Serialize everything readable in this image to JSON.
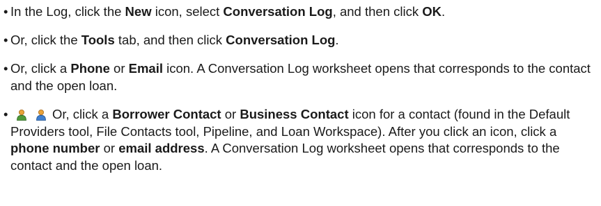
{
  "bullet_char": "•",
  "items": [
    {
      "segments": [
        {
          "text": "In the Log, click the ",
          "bold": false
        },
        {
          "text": "New",
          "bold": true
        },
        {
          "text": " icon, select ",
          "bold": false
        },
        {
          "text": "Conversation Log",
          "bold": true
        },
        {
          "text": ", and then click ",
          "bold": false
        },
        {
          "text": "OK",
          "bold": true
        },
        {
          "text": ".",
          "bold": false
        }
      ]
    },
    {
      "segments": [
        {
          "text": "Or, click the ",
          "bold": false
        },
        {
          "text": "Tools",
          "bold": true
        },
        {
          "text": " tab, and then click ",
          "bold": false
        },
        {
          "text": "Conversation Log",
          "bold": true
        },
        {
          "text": ".",
          "bold": false
        }
      ]
    },
    {
      "segments": [
        {
          "text": "Or, click a ",
          "bold": false
        },
        {
          "text": "Phone",
          "bold": true
        },
        {
          "text": " or ",
          "bold": false
        },
        {
          "text": "Email",
          "bold": true
        },
        {
          "text": " icon. A Conversation Log worksheet opens that corresponds to the contact and the open loan.",
          "bold": false
        }
      ]
    },
    {
      "icons": [
        {
          "name": "borrower-contact-icon",
          "color": "#e8a33a"
        },
        {
          "name": "business-contact-icon",
          "color": "#3f7fcf"
        }
      ],
      "segments": [
        {
          "text": "Or, click a ",
          "bold": false
        },
        {
          "text": "Borrower Contact",
          "bold": true
        },
        {
          "text": " or ",
          "bold": false
        },
        {
          "text": "Business Contact",
          "bold": true
        },
        {
          "text": " icon for a contact (found in the Default Providers tool, File Contacts tool, Pipeline, and Loan Workspace). After you click an icon, click a ",
          "bold": false
        },
        {
          "text": "phone number",
          "bold": true
        },
        {
          "text": " or ",
          "bold": false
        },
        {
          "text": "email address",
          "bold": true
        },
        {
          "text": ". A Conversation Log worksheet opens that corresponds to the contact and the open loan.",
          "bold": false
        }
      ]
    }
  ]
}
